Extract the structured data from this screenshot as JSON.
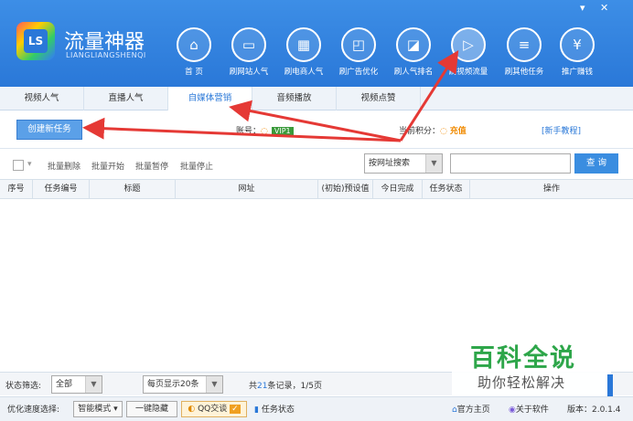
{
  "app": {
    "title": "流量神器",
    "subtitle": "LIANGLIANGSHENQI",
    "logo_text": "LS",
    "brand_color": "#2a78d8"
  },
  "window_controls": {
    "minimize": "▾",
    "close": "✕"
  },
  "nav": [
    {
      "label": "首 页",
      "icon": "home-icon",
      "glyph": "⌂"
    },
    {
      "label": "刷网站人气",
      "icon": "monitor-icon",
      "glyph": "▭"
    },
    {
      "label": "刷电商人气",
      "icon": "store-icon",
      "glyph": "▦"
    },
    {
      "label": "刷广告优化",
      "icon": "ad-icon",
      "glyph": "◰"
    },
    {
      "label": "刷人气排名",
      "icon": "chart-board-icon",
      "glyph": "◪"
    },
    {
      "label": "刷视频流量",
      "icon": "video-icon",
      "glyph": "▷",
      "active": true
    },
    {
      "label": "刷其他任务",
      "icon": "list-icon",
      "glyph": "≡"
    },
    {
      "label": "推广赚钱",
      "icon": "money-bag-icon",
      "glyph": "¥"
    }
  ],
  "tabs": [
    "视频人气",
    "直播人气",
    "自媒体营销",
    "音频播放",
    "视频点赞"
  ],
  "active_tab": 2,
  "account": {
    "new_task": "创建新任务",
    "account_label": "账号：",
    "vip": "VIP1",
    "points_label": "当前积分：",
    "recharge": "充值",
    "help": "[新手教程]"
  },
  "toolbar": {
    "batch_delete": "批量删除",
    "batch_start": "批量开始",
    "batch_pause": "批量暂停",
    "batch_stop": "批量停止",
    "search_mode": "按网址搜索",
    "query": "查 询"
  },
  "table": {
    "columns": [
      "序号",
      "任务编号",
      "标题",
      "网址",
      "(初始)预设值",
      "今日完成",
      "任务状态",
      "操作"
    ]
  },
  "status": {
    "filter_label": "状态筛选:",
    "filter_value": "全部",
    "page_size": "每页显示20条",
    "records_prefix": "共",
    "records_count": "21",
    "records_suffix": "条记录，1/5页"
  },
  "bottom": {
    "speed_label": "优化速度选择:",
    "speed_value": "智能模式",
    "hide_button": "一键隐藏",
    "qq_label": "QQ交谈",
    "task_status": "任务状态",
    "home_link": "官方主页",
    "about_link": "关于软件",
    "version": "版本：2.0.1.4"
  },
  "watermark": {
    "line1": "百科全说",
    "line2": "助你轻松解决",
    "color": "#2ea64a"
  },
  "annotation_color": "#e53935"
}
